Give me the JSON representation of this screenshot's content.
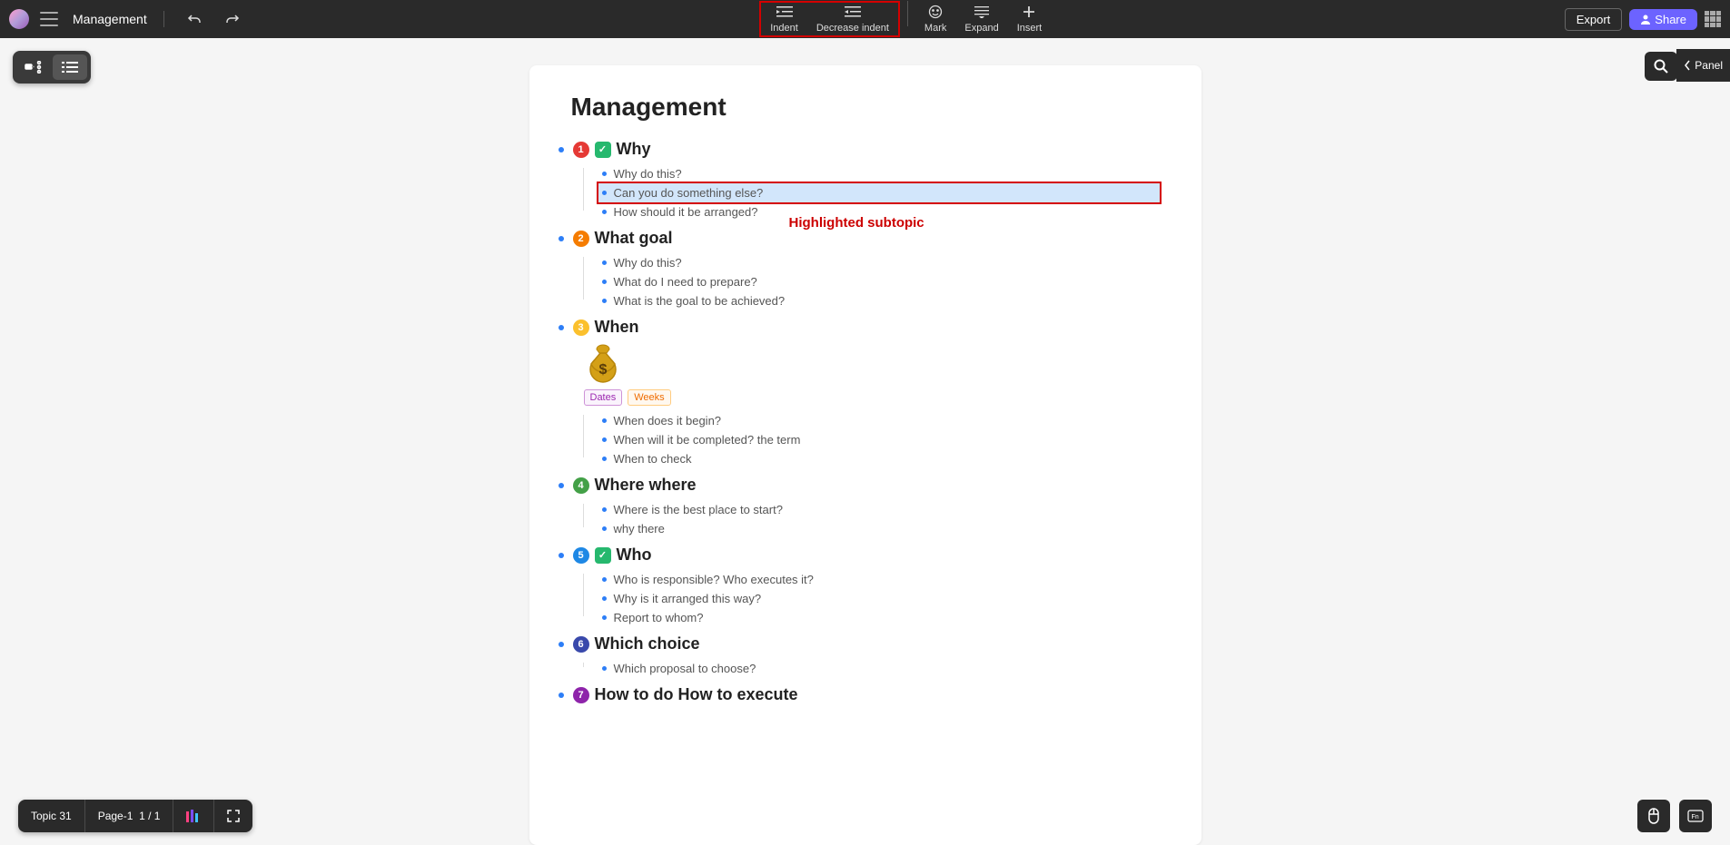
{
  "header": {
    "doc_title": "Management",
    "tools": {
      "indent": "Indent",
      "decrease_indent": "Decrease indent",
      "mark": "Mark",
      "expand": "Expand",
      "insert": "Insert"
    },
    "export": "Export",
    "share": "Share"
  },
  "panel_label": "Panel",
  "status": {
    "topic": "Topic 31",
    "page_label": "Page-1",
    "page_num": "1 / 1"
  },
  "annotation": "Highlighted subtopic",
  "doc": {
    "title": "Management",
    "topics": [
      {
        "num": "1",
        "color": "c1",
        "check": true,
        "title": "Why",
        "subs": [
          "Why do this?",
          "Can you do something else?",
          "How should it be arranged?"
        ],
        "highlight_idx": 1
      },
      {
        "num": "2",
        "color": "c2",
        "check": false,
        "title": "What goal",
        "subs": [
          "Why do this?",
          "What do I need to prepare?",
          "What is the goal to be achieved?"
        ]
      },
      {
        "num": "3",
        "color": "c3",
        "check": false,
        "title": "When",
        "special": "when",
        "subs": [
          "When does it begin?",
          "When will it be completed? the term",
          "When to check"
        ]
      },
      {
        "num": "4",
        "color": "c4",
        "check": false,
        "title": "Where where",
        "subs": [
          "Where is the best place to start?",
          "why there"
        ]
      },
      {
        "num": "5",
        "color": "c5",
        "check": true,
        "title": "Who",
        "subs": [
          "Who is responsible? Who executes it?",
          "Why is it arranged this way?",
          "Report to whom?"
        ]
      },
      {
        "num": "6",
        "color": "c6",
        "check": false,
        "title": "Which choice",
        "subs": [
          "Which proposal to choose?"
        ]
      },
      {
        "num": "7",
        "color": "c7",
        "check": false,
        "title": "How to do How to execute",
        "subs": []
      }
    ],
    "tags": {
      "dates": "Dates",
      "weeks": "Weeks"
    }
  }
}
